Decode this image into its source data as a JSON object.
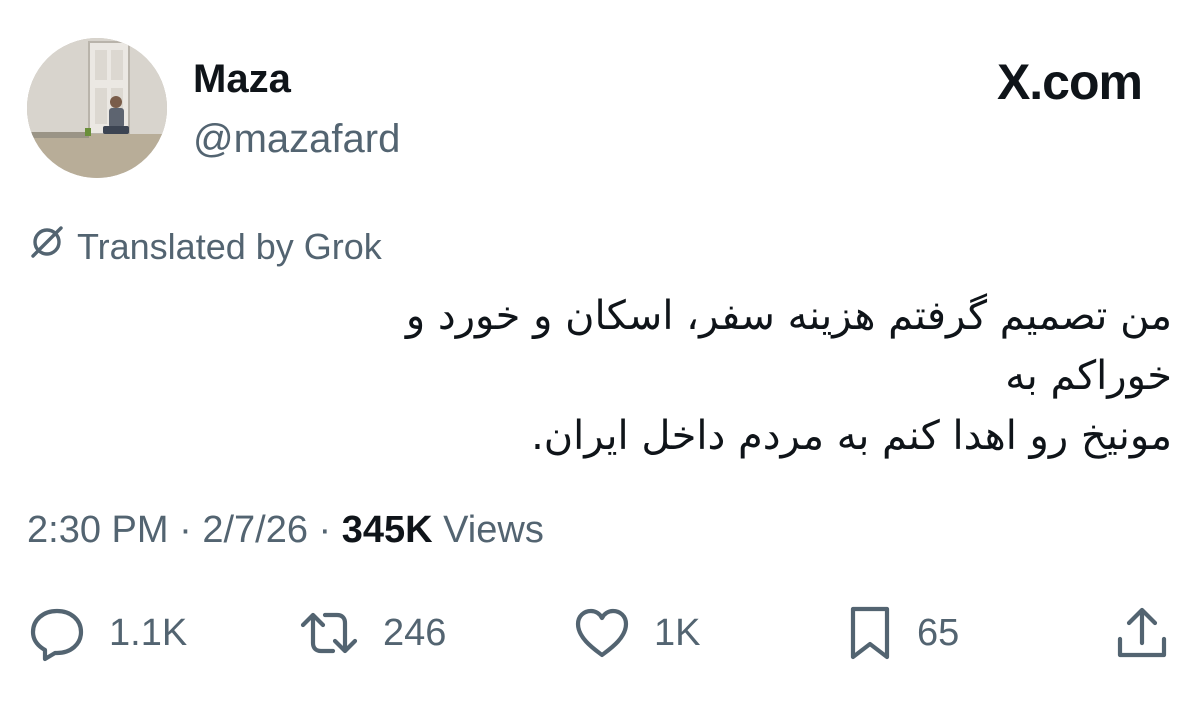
{
  "tweet": {
    "author_name": "Maza",
    "author_handle": "@mazafard",
    "brand": "X.com",
    "translated_label": "Translated by Grok",
    "text": "من تصمیم گرفتم هزینه سفر، اسکان و خورد و خوراکم به\nمونیخ رو اهدا کنم به مردم داخل ایران.",
    "time": "2:30 PM",
    "sep1": " · ",
    "date": "2/7/26",
    "sep2": " · ",
    "views_count": "345K",
    "views_label": " Views"
  },
  "actions": {
    "replies": "1.1K",
    "reposts": "246",
    "likes": "1K",
    "bookmarks": "65"
  },
  "icons": {
    "brand": "x-logo-icon",
    "translate": "grok-icon",
    "reply": "reply-icon",
    "repost": "repost-icon",
    "like": "heart-icon",
    "bookmark": "bookmark-icon",
    "share": "share-icon"
  },
  "colors": {
    "text": "#0f1419",
    "secondary": "#536471",
    "background": "#ffffff"
  }
}
